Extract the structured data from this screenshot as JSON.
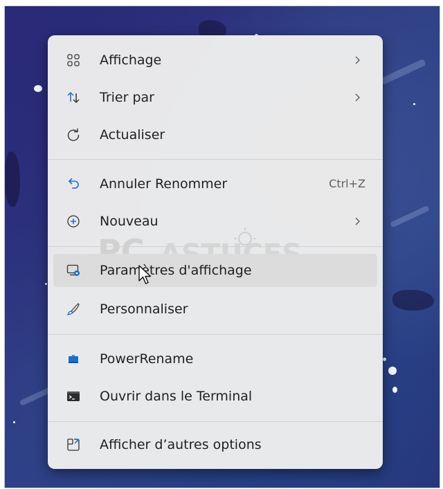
{
  "context_menu": {
    "items": [
      {
        "icon": "grid-view-icon",
        "label": "Affichage",
        "submenu": true
      },
      {
        "icon": "sort-arrows-icon",
        "label": "Trier par",
        "submenu": true
      },
      {
        "icon": "refresh-icon",
        "label": "Actualiser"
      },
      {
        "icon": "undo-icon",
        "label": "Annuler Renommer",
        "shortcut": "Ctrl+Z"
      },
      {
        "icon": "add-circle-icon",
        "label": "Nouveau",
        "submenu": true
      },
      {
        "icon": "display-settings-icon",
        "label": "Paramètres d'affichage",
        "hovered": true
      },
      {
        "icon": "paintbrush-icon",
        "label": "Personnaliser"
      },
      {
        "icon": "powerrename-icon",
        "label": "PowerRename"
      },
      {
        "icon": "terminal-icon",
        "label": "Ouvrir dans le Terminal"
      },
      {
        "icon": "more-options-icon",
        "label": "Afficher d’autres options"
      }
    ]
  },
  "watermark": {
    "text": "PC ASTUCES"
  },
  "colors": {
    "menu_background": "#ececec",
    "hover_background": "#dcdcdc",
    "accent_blue": "#1a6fc9",
    "text": "#1f1f1f",
    "desktop_background": "#2c3a82"
  }
}
